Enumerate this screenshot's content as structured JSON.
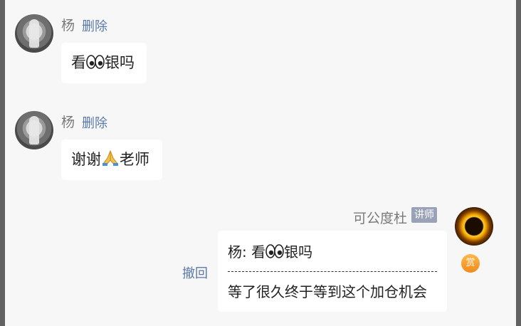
{
  "messages": [
    {
      "sender": "杨",
      "action": "删除",
      "text_before": "看",
      "emoji": "eyes",
      "text_after": "银吗"
    },
    {
      "sender": "杨",
      "action": "删除",
      "text_before": "谢谢",
      "emoji": "folded-hands",
      "text_after": "老师"
    }
  ],
  "reply": {
    "sender": "可公度杜",
    "badge": "讲师",
    "reward_label": "赏",
    "recall_label": "撤回",
    "quote_prefix": "杨: 看",
    "quote_emoji": "eyes",
    "quote_suffix": "银吗",
    "text": "等了很久终于等到这个加仓机会"
  },
  "colors": {
    "background": "#f8f7f8",
    "link": "#5a7aa8",
    "badge": "#9aa2b7",
    "reward": "#f59a2a"
  }
}
